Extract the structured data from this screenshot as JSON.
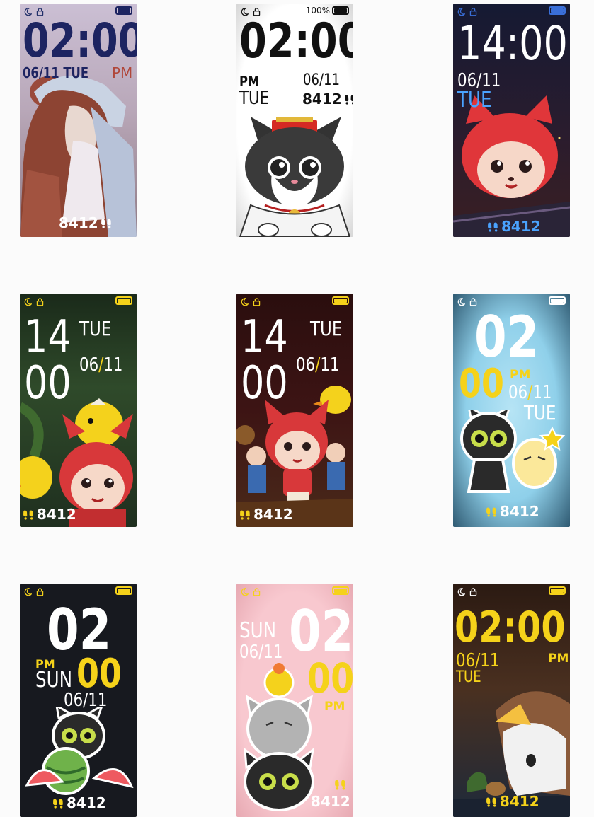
{
  "watch_faces": [
    {
      "id": "girl",
      "time": "02:00",
      "date": "06/11",
      "day": "TUE",
      "ampm": "PM",
      "steps": "8412"
    },
    {
      "id": "cat",
      "battery_percent": "100%",
      "time": "02:00",
      "ampm": "PM",
      "date": "06/11",
      "day": "TUE",
      "steps": "8412"
    },
    {
      "id": "fox-night",
      "time": "14:00",
      "date": "06/11",
      "day": "TUE",
      "steps": "8412"
    },
    {
      "id": "fox-chick",
      "hour": "14",
      "minute": "00",
      "day": "TUE",
      "date_month": "06",
      "date_day": "11",
      "date_sep": "/",
      "steps": "8412"
    },
    {
      "id": "fox-stage",
      "hour": "14",
      "minute": "00",
      "day": "TUE",
      "date_month": "06",
      "date_day": "11",
      "date_sep": "/",
      "steps": "8412"
    },
    {
      "id": "blue-cat",
      "hour": "02",
      "minute": "00",
      "ampm": "PM",
      "date_month": "06",
      "date_day": "11",
      "date_sep": "/",
      "day": "TUE",
      "steps": "8412"
    },
    {
      "id": "dark-melon",
      "hour": "02",
      "ampm": "PM",
      "day": "SUN",
      "minute": "00",
      "date": "06/11",
      "steps": "8412"
    },
    {
      "id": "pink",
      "day": "SUN",
      "hour": "02",
      "date": "06/11",
      "minute": "00",
      "ampm": "PM",
      "steps": "8412"
    },
    {
      "id": "night-bird",
      "time": "02:00",
      "date": "06/11",
      "ampm": "PM",
      "day": "TUE",
      "steps": "8412"
    }
  ],
  "icons": [
    "moon-icon",
    "lock-icon",
    "battery-icon",
    "footsteps-icon"
  ],
  "colors": {
    "yellow": "#f5d21a",
    "navy": "#1d2461",
    "accent_blue": "#4aa3ff",
    "page_bg": "#fbfbfb"
  }
}
